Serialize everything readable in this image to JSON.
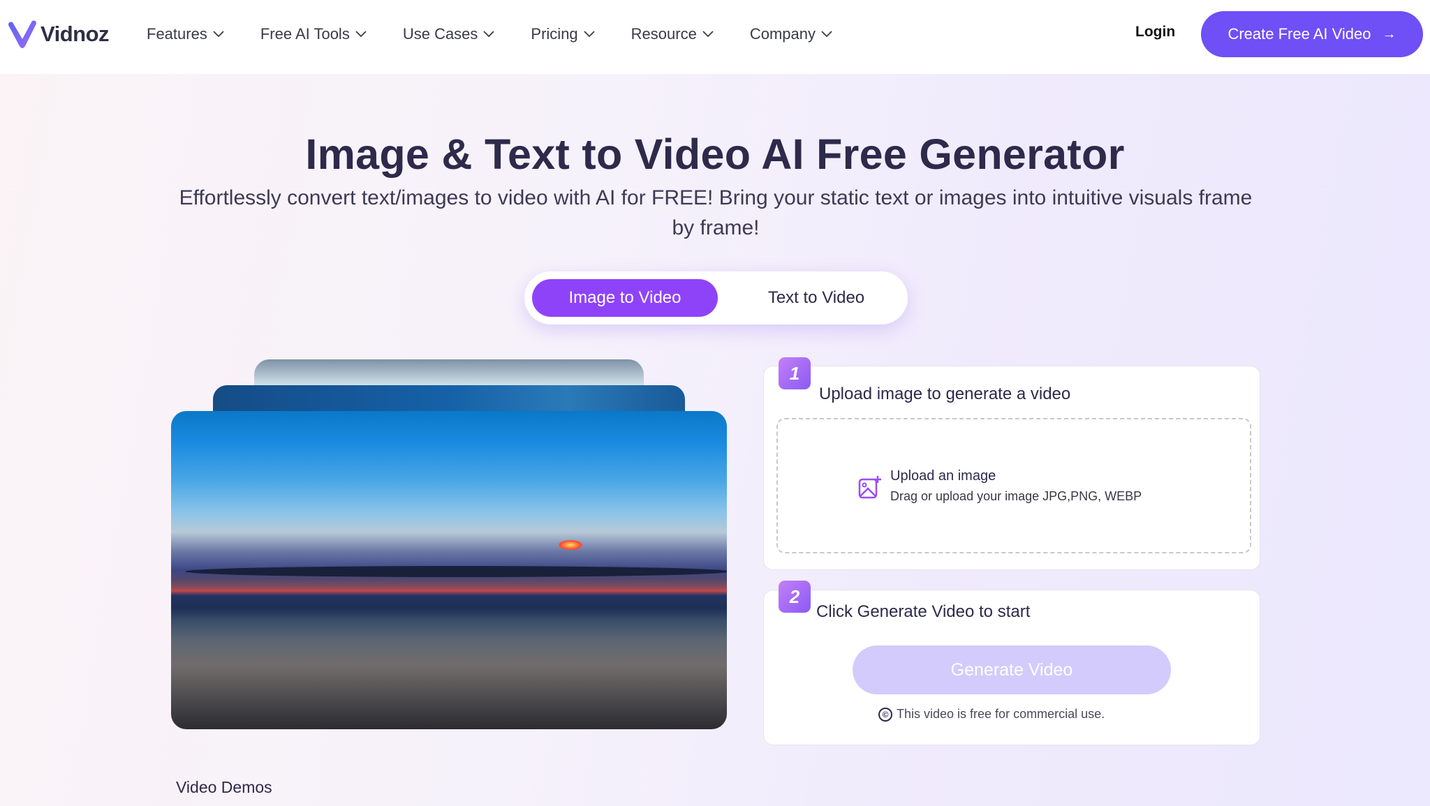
{
  "nav": {
    "brand": "Vidnoz",
    "menu": [
      {
        "label": "Features"
      },
      {
        "label": "Free AI Tools"
      },
      {
        "label": "Use Cases"
      },
      {
        "label": "Pricing"
      },
      {
        "label": "Resource"
      },
      {
        "label": "Company"
      }
    ],
    "login": "Login",
    "cta": "Create Free AI Video",
    "cta_icon": "→"
  },
  "hero": {
    "title": "Image & Text to Video AI Free Generator",
    "subtitle": "Effortlessly convert text/images to video with AI for FREE! Bring your static text or images into intuitive visuals frame by frame!"
  },
  "tabs": [
    {
      "label": "Image to Video",
      "active": true
    },
    {
      "label": "Text to Video",
      "active": false
    }
  ],
  "steps": {
    "step1": {
      "number": "1",
      "title": "Upload image to generate a video",
      "upload_title": "Upload an image",
      "upload_hint": "Drag or upload your image JPG,PNG, WEBP"
    },
    "step2": {
      "number": "2",
      "title": "Click Generate Video to start",
      "button": "Generate Video",
      "note_icon": "©",
      "note": "This video is free for commercial use."
    }
  },
  "demos_label": "Video Demos",
  "colors": {
    "accent": "#6f4ff6",
    "tab_active": "#8f43f9",
    "generate_disabled": "#d3cbfb"
  }
}
